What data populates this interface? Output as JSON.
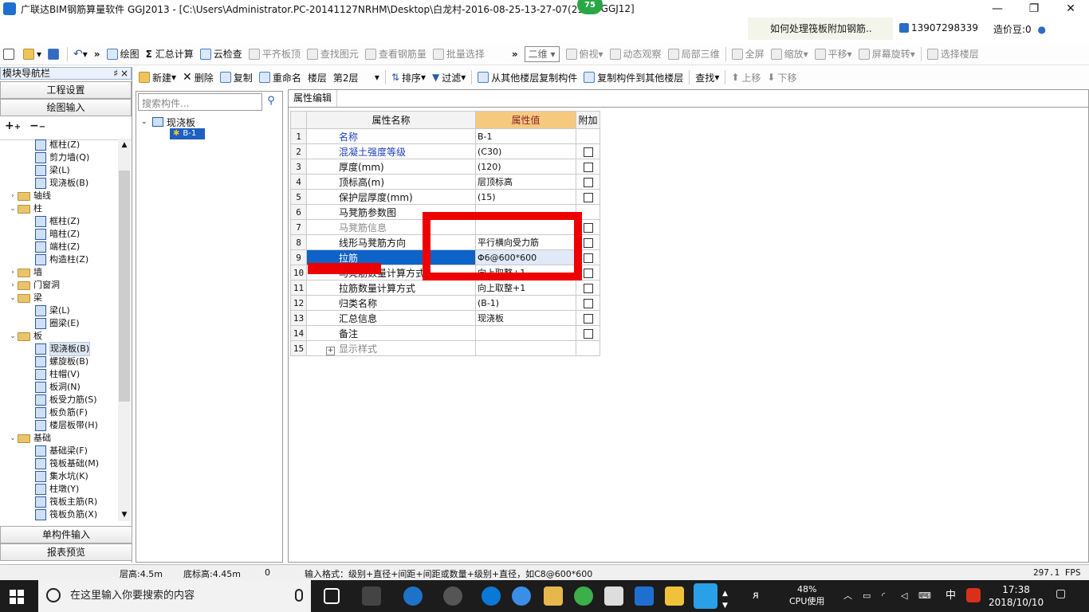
{
  "window": {
    "title": "广联达BIM钢筋算量软件 GGJ2013 - [C:\\Users\\Administrator.PC-20141127NRHM\\Desktop\\白龙村-2016-08-25-13-27-07(216",
    "title_suffix": "GGJ12]",
    "badge": "75"
  },
  "infobar": {
    "link": "如何处理筏板附加钢筋..",
    "user": "13907298339",
    "coin": "造价豆:0"
  },
  "toolbar1": {
    "draw": "绘图",
    "sum": "汇总计算",
    "cloud_check": "云检查",
    "flat_top": "平齐板顶",
    "find_elem": "查找图元",
    "view_rebar": "查看钢筋量",
    "batch_select": "批量选择",
    "view_mode": "二维",
    "top_view": "俯视",
    "dynamic_view": "动态观察",
    "local_3d": "局部三维",
    "fullscreen": "全屏",
    "zoom": "缩放",
    "pan": "平移",
    "rotate": "屏幕旋转",
    "select_floor": "选择楼层"
  },
  "toolbar2": {
    "new": "新建",
    "delete": "删除",
    "copy": "复制",
    "rename": "重命名",
    "floor_label": "楼层",
    "floor_value": "第2层",
    "sort": "排序",
    "filter": "过滤",
    "copy_from_other": "从其他楼层复制构件",
    "copy_to_other": "复制构件到其他楼层",
    "find": "查找",
    "move_up": "上移",
    "move_down": "下移"
  },
  "leftpanel": {
    "title": "模块导航栏",
    "pin": "♯",
    "close": "×",
    "buttons": [
      "工程设置",
      "绘图输入"
    ],
    "bottom_buttons": [
      "单构件输入",
      "报表预览"
    ],
    "tree": [
      {
        "label": "框柱(Z)",
        "level": 2
      },
      {
        "label": "剪力墙(Q)",
        "level": 2
      },
      {
        "label": "梁(L)",
        "level": 2
      },
      {
        "label": "现浇板(B)",
        "level": 2
      },
      {
        "label": "轴线",
        "level": 1,
        "arrow": "›"
      },
      {
        "label": "柱",
        "level": 1,
        "arrow": "⌄"
      },
      {
        "label": "框柱(Z)",
        "level": 2
      },
      {
        "label": "暗柱(Z)",
        "level": 2
      },
      {
        "label": "端柱(Z)",
        "level": 2
      },
      {
        "label": "构造柱(Z)",
        "level": 2
      },
      {
        "label": "墙",
        "level": 1,
        "arrow": "›"
      },
      {
        "label": "门窗洞",
        "level": 1,
        "arrow": "›"
      },
      {
        "label": "梁",
        "level": 1,
        "arrow": "⌄"
      },
      {
        "label": "梁(L)",
        "level": 2
      },
      {
        "label": "圈梁(E)",
        "level": 2
      },
      {
        "label": "板",
        "level": 1,
        "arrow": "⌄"
      },
      {
        "label": "现浇板(B)",
        "level": 2,
        "selected": true
      },
      {
        "label": "螺旋板(B)",
        "level": 2
      },
      {
        "label": "柱帽(V)",
        "level": 2
      },
      {
        "label": "板洞(N)",
        "level": 2
      },
      {
        "label": "板受力筋(S)",
        "level": 2
      },
      {
        "label": "板负筋(F)",
        "level": 2
      },
      {
        "label": "楼层板带(H)",
        "level": 2
      },
      {
        "label": "基础",
        "level": 1,
        "arrow": "⌄"
      },
      {
        "label": "基础梁(F)",
        "level": 2
      },
      {
        "label": "筏板基础(M)",
        "level": 2
      },
      {
        "label": "集水坑(K)",
        "level": 2
      },
      {
        "label": "柱墩(Y)",
        "level": 2
      },
      {
        "label": "筏板主筋(R)",
        "level": 2
      },
      {
        "label": "筏板负筋(X)",
        "level": 2
      }
    ]
  },
  "midpanel": {
    "search_placeholder": "搜索构件...",
    "tree_root": "现浇板",
    "tree_child": "B-1"
  },
  "props": {
    "tab": "属性编辑",
    "col_name": "属性名称",
    "col_value": "属性值",
    "col_extra": "附加",
    "rows": [
      {
        "num": "1",
        "name": "名称",
        "value": "B-1",
        "blue": true,
        "checkbox": false
      },
      {
        "num": "2",
        "name": "混凝土强度等级",
        "value": "(C30)",
        "blue": true,
        "checkbox": true
      },
      {
        "num": "3",
        "name": "厚度(mm)",
        "value": "(120)",
        "checkbox": true
      },
      {
        "num": "4",
        "name": "顶标高(m)",
        "value": "层顶标高",
        "checkbox": true
      },
      {
        "num": "5",
        "name": "保护层厚度(mm)",
        "value": "(15)",
        "checkbox": true
      },
      {
        "num": "6",
        "name": "马凳筋参数图",
        "value": "",
        "checkbox": false
      },
      {
        "num": "7",
        "name": "马凳筋信息",
        "value": "",
        "grey": true,
        "checkbox": true
      },
      {
        "num": "8",
        "name": "线形马凳筋方向",
        "value": "平行横向受力筋",
        "checkbox": true
      },
      {
        "num": "9",
        "name": "拉筋",
        "value": "Φ6@600*600",
        "selected": true,
        "checkbox": true
      },
      {
        "num": "10",
        "name": "马凳筋数量计算方式",
        "value": "向上取整+1",
        "checkbox": true
      },
      {
        "num": "11",
        "name": "拉筋数量计算方式",
        "value": "向上取整+1",
        "checkbox": true
      },
      {
        "num": "12",
        "name": "归类名称",
        "value": "(B-1)",
        "checkbox": true
      },
      {
        "num": "13",
        "name": "汇总信息",
        "value": "现浇板",
        "checkbox": true
      },
      {
        "num": "14",
        "name": "备注",
        "value": "",
        "checkbox": true
      },
      {
        "num": "15",
        "name": "显示样式",
        "value": "",
        "grey": true,
        "expander": "+",
        "checkbox": false
      }
    ]
  },
  "statusbar": {
    "floor_height": "层高:4.5m",
    "base_elev": "底标高:4.45m",
    "zero": "0",
    "hint": "输入格式：级别+直径+间距+间距或数量+级别+直径，如C8@600*600",
    "fps": "297.1 FPS"
  },
  "taskbar": {
    "search_text": "在这里输入你要搜索的内容",
    "cpu_pct": "48%",
    "cpu_label": "CPU使用",
    "ime": "中",
    "time": "17:38",
    "date": "2018/10/10"
  },
  "colors": {
    "highlight_box": "#ee0000",
    "selection": "#0e63c8",
    "value_header": "#f6c981"
  }
}
